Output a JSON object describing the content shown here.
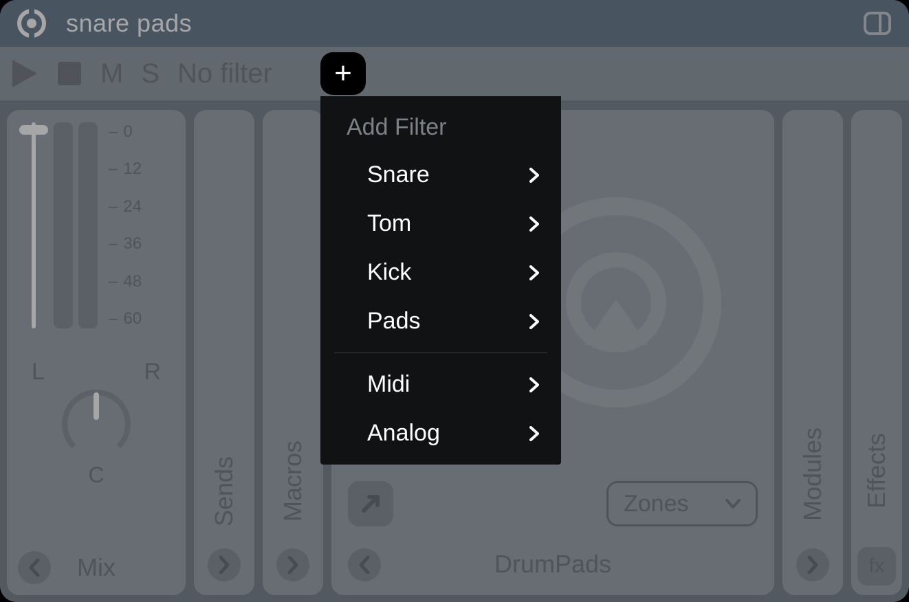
{
  "titlebar": {
    "title": "snare pads"
  },
  "toolbar": {
    "mute_label": "M",
    "solo_label": "S",
    "filter_label": "No filter"
  },
  "mix": {
    "scale": [
      "0",
      "12",
      "24",
      "36",
      "48",
      "60"
    ],
    "pan_left": "L",
    "pan_right": "R",
    "pan_center": "C",
    "label": "Mix"
  },
  "sends": {
    "label": "Sends"
  },
  "macros": {
    "label": "Macros"
  },
  "drumpads": {
    "zones_label": "Zones",
    "label": "DrumPads"
  },
  "modules": {
    "label": "Modules"
  },
  "effects": {
    "label": "Effects",
    "fx_label": "fx"
  },
  "dropdown": {
    "title": "Add Filter",
    "group1": [
      "Snare",
      "Tom",
      "Kick",
      "Pads"
    ],
    "group2": [
      "Midi",
      "Analog"
    ]
  }
}
